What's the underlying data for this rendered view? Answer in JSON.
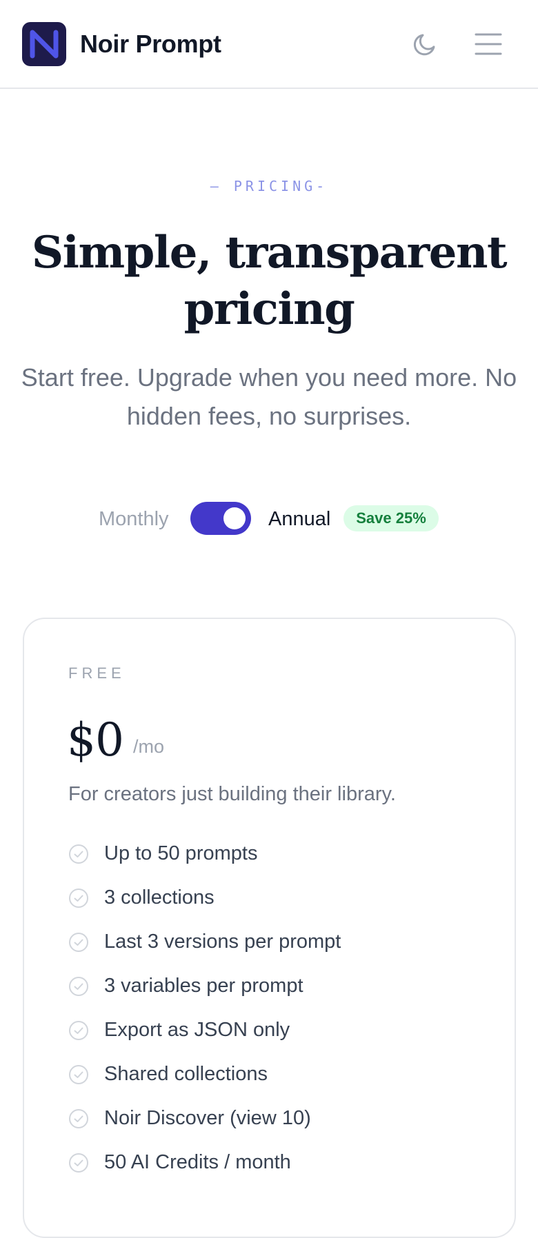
{
  "header": {
    "brand": "Noir Prompt",
    "logo_icon": "noir-n-logo-icon",
    "theme_icon": "moon-icon",
    "menu_icon": "hamburger-menu-icon",
    "accent": "#4f55e8",
    "logo_bg": "#1e1b4b"
  },
  "hero": {
    "eyebrow": "— PRICING-",
    "title": "Simple, transparent pricing",
    "subtitle": "Start free. Upgrade when you need more. No hidden fees, no surprises."
  },
  "billing": {
    "monthly_label": "Monthly",
    "annual_label": "Annual",
    "save_badge": "Save 25%",
    "selected": "Annual",
    "toggle_color": "#4338ca",
    "badge_bg": "#dcfce7",
    "badge_color": "#15803d"
  },
  "plans": [
    {
      "name": "FREE",
      "price": "$0",
      "period": "/mo",
      "description": "For creators just building their library.",
      "features": [
        "Up to 50 prompts",
        "3 collections",
        "Last 3 versions per prompt",
        "3 variables per prompt",
        "Export as JSON only",
        "Shared collections",
        "Noir Discover (view 10)",
        "50 AI Credits / month"
      ]
    }
  ]
}
